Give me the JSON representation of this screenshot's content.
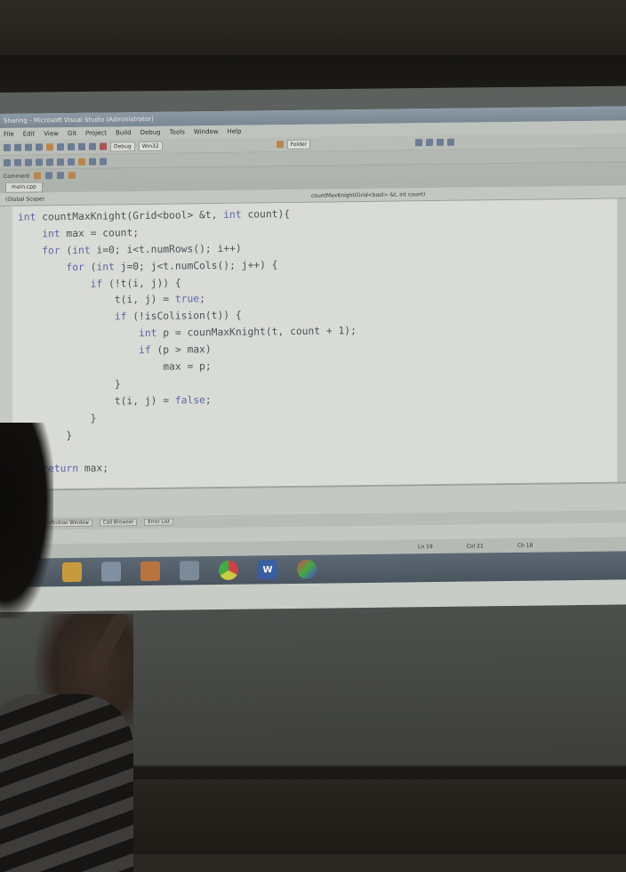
{
  "window": {
    "title": "Sharing - Microsoft Visual Studio (Administrator)",
    "menu": [
      "File",
      "Edit",
      "View",
      "Git",
      "Project",
      "Build",
      "Debug",
      "Tools",
      "Window",
      "Help"
    ],
    "toolbar": {
      "config": "Debug",
      "platform": "Win32",
      "find_label": "Folder"
    },
    "toolbar3_label": "Comment",
    "file_tab": "main.cpp",
    "nav_scope": "(Global Scope)",
    "nav_member": "countMaxKnight(Grid<bool> &t, int count)"
  },
  "code_lines": [
    "int countMaxKnight(Grid<bool> &t, int count){",
    "    int max = count;",
    "    for (int i=0; i<t.numRows(); i++)",
    "        for (int j=0; j<t.numCols(); j++) {",
    "            if (!t(i, j)) {",
    "                t(i, j) = true;",
    "                if (!isColision(t)) {",
    "                    int p = counMaxKnight(t, count + 1);",
    "                    if (p > max)",
    "                        max = p;",
    "                }",
    "                t(i, j) = false;",
    "            }",
    "        }",
    "",
    "    return max;"
  ],
  "bottom_tabs": [
    "Code Definition Window",
    "Call Browser",
    "Error List"
  ],
  "status": {
    "line": "Ln 19",
    "col": "Col 21",
    "ch": "Ch 18"
  },
  "taskbar_icons": [
    "explorer-icon",
    "box-icon",
    "media-icon",
    "chrome-icon",
    "word-icon",
    "paint-icon"
  ],
  "taskbar_word_letter": "W"
}
